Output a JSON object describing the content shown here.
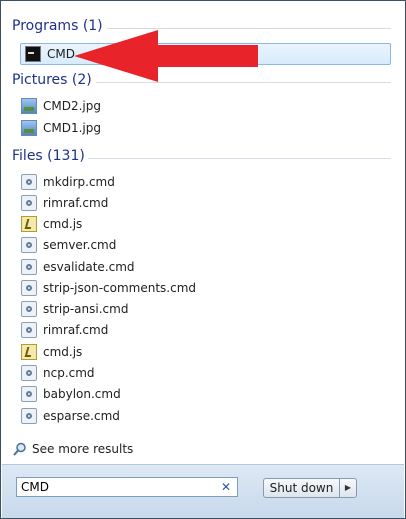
{
  "sections": {
    "programs": {
      "header": "Programs (1)",
      "items": [
        {
          "label": "CMD",
          "icon": "console-icon"
        }
      ]
    },
    "pictures": {
      "header": "Pictures (2)",
      "items": [
        {
          "label": "CMD2.jpg",
          "icon": "image-file-icon"
        },
        {
          "label": "CMD1.jpg",
          "icon": "image-file-icon"
        }
      ]
    },
    "files": {
      "header": "Files (131)",
      "items": [
        {
          "label": "mkdirp.cmd",
          "icon": "cmd-file-icon"
        },
        {
          "label": "rimraf.cmd",
          "icon": "cmd-file-icon"
        },
        {
          "label": "cmd.js",
          "icon": "js-file-icon"
        },
        {
          "label": "semver.cmd",
          "icon": "cmd-file-icon"
        },
        {
          "label": "esvalidate.cmd",
          "icon": "cmd-file-icon"
        },
        {
          "label": "strip-json-comments.cmd",
          "icon": "cmd-file-icon"
        },
        {
          "label": "strip-ansi.cmd",
          "icon": "cmd-file-icon"
        },
        {
          "label": "rimraf.cmd",
          "icon": "cmd-file-icon"
        },
        {
          "label": "cmd.js",
          "icon": "js-file-icon"
        },
        {
          "label": "ncp.cmd",
          "icon": "cmd-file-icon"
        },
        {
          "label": "babylon.cmd",
          "icon": "cmd-file-icon"
        },
        {
          "label": "esparse.cmd",
          "icon": "cmd-file-icon"
        }
      ]
    }
  },
  "see_more": {
    "label": "See more results",
    "icon": "search-icon"
  },
  "search": {
    "value": "CMD",
    "clear_icon": "clear-icon"
  },
  "shutdown": {
    "label": "Shut down",
    "arrow_icon": "chevron-right-icon"
  },
  "annotation": {
    "icon": "red-arrow-icon",
    "color": "#e8232a"
  },
  "colors": {
    "header_text": "#1e3287",
    "selection": "#d8ebfb",
    "footer_bg": "#c8d9ec"
  }
}
